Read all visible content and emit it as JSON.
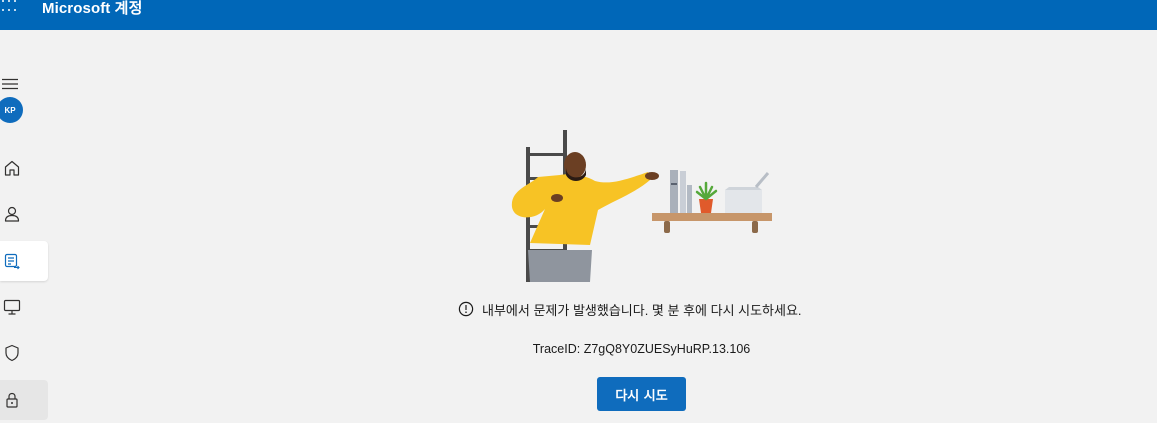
{
  "header": {
    "app_title": "Microsoft 계정"
  },
  "sidebar": {
    "avatar_initials": "KP",
    "items": [
      "home",
      "person",
      "subscriptions",
      "devices",
      "security",
      "privacy"
    ]
  },
  "error": {
    "message": "내부에서 문제가 발생했습니다. 몇 분 후에 다시 시도하세요.",
    "trace": "TraceID: Z7gQ8Y0ZUESyHuRP.13.106",
    "retry_label": "다시 시도"
  },
  "colors": {
    "brand": "#0067b8",
    "button": "#0f6cbd",
    "background": "#f2f2f2"
  }
}
